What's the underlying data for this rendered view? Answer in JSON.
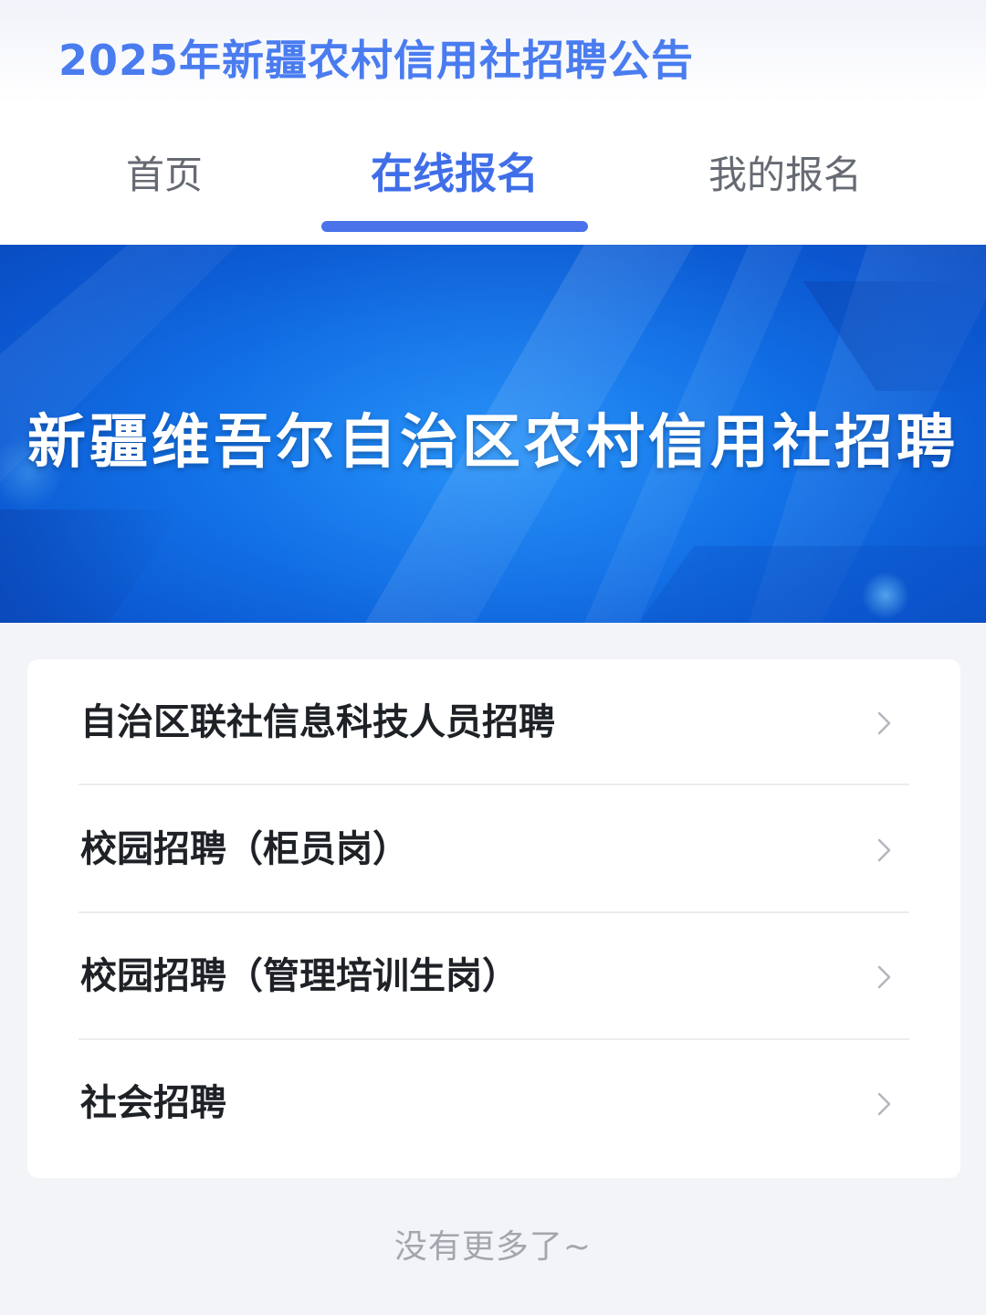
{
  "header": {
    "title": "2025年新疆农村信用社招聘公告"
  },
  "tabs": [
    {
      "label": "首页",
      "active": false
    },
    {
      "label": "在线报名",
      "active": true
    },
    {
      "label": "我的报名",
      "active": false
    }
  ],
  "banner": {
    "title": "新疆维吾尔自治区农村信用社招聘"
  },
  "list": {
    "items": [
      {
        "label": "自治区联社信息科技人员招聘",
        "icon": "chevron-right-icon"
      },
      {
        "label": "校园招聘（柜员岗）",
        "icon": "chevron-right-icon"
      },
      {
        "label": "校园招聘（管理培训生岗）",
        "icon": "chevron-right-icon"
      },
      {
        "label": "社会招聘",
        "icon": "chevron-right-icon"
      }
    ]
  },
  "footer": {
    "note": "没有更多了~"
  },
  "colors": {
    "accent": "#3f6ee8",
    "banner": "#1270e6",
    "background": "#f3f4f7"
  }
}
